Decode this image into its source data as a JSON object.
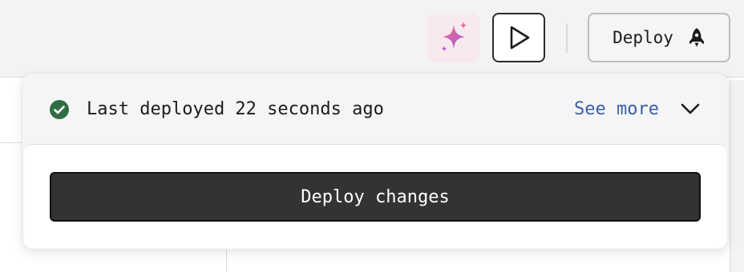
{
  "toolbar": {
    "ai_icon": "sparkles-icon",
    "run_icon": "play-icon",
    "deploy_label": "Deploy",
    "deploy_icon": "rocket-icon"
  },
  "deploy_popover": {
    "status_icon": "check-circle-icon",
    "status_color": "#2f6e44",
    "status_text": "Last deployed 22 seconds ago",
    "see_more_label": "See more",
    "see_more_color": "#3a5ea8",
    "collapse_icon": "chevron-down-icon",
    "deploy_changes_label": "Deploy changes"
  },
  "colors": {
    "ai_gradient_start": "#f06a8a",
    "ai_gradient_end": "#a35ee0",
    "primary_button_bg": "#333333"
  }
}
